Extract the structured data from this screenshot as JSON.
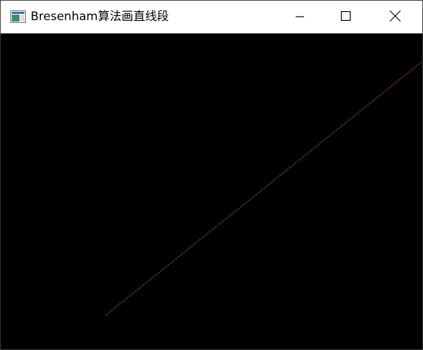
{
  "window": {
    "title": "Bresenham算法画直线段",
    "icon": "app-window-icon"
  },
  "caption_buttons": {
    "minimize_icon": "minimize-icon",
    "maximize_icon": "maximize-icon",
    "close_icon": "close-icon"
  },
  "canvas": {
    "background": "#000000",
    "line_color": "#a0522d",
    "line_icon": "dotted-line"
  }
}
